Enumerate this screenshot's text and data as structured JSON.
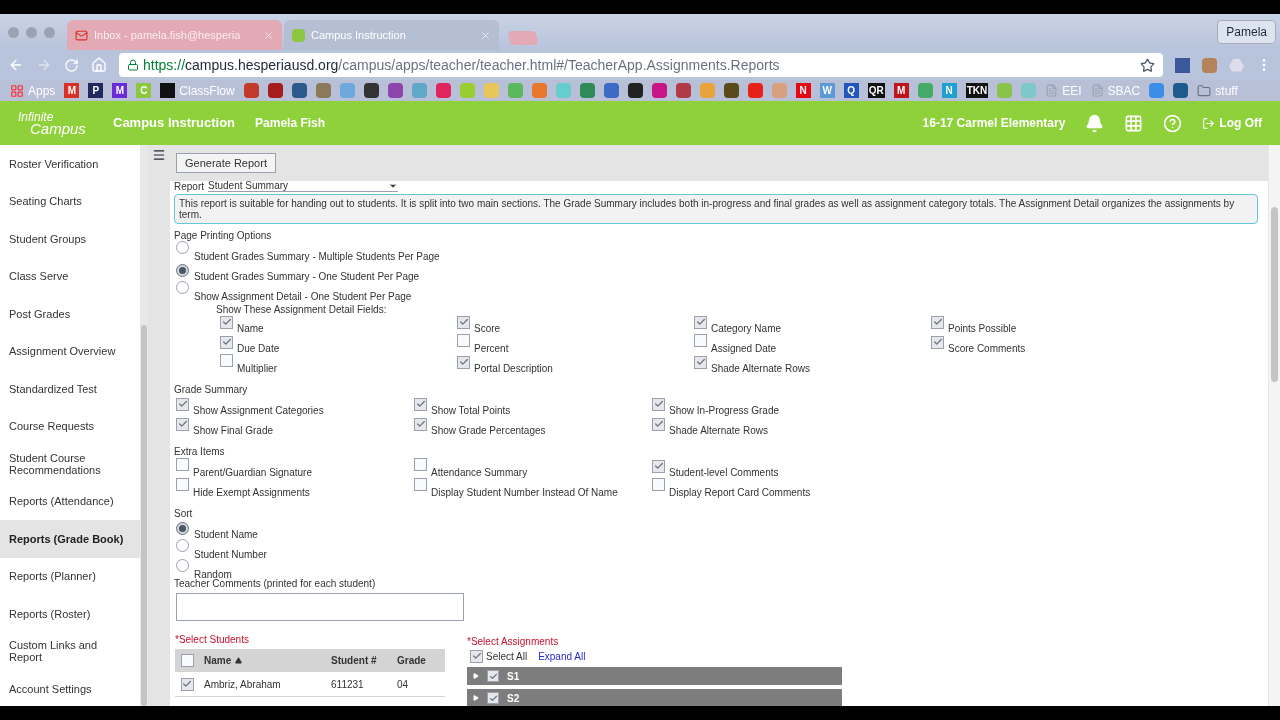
{
  "browser": {
    "tabs": [
      {
        "title": "Inbox - pamela.fish@hesperia",
        "selected": false
      },
      {
        "title": "Campus Instruction",
        "selected": true
      }
    ],
    "profile": "Pamela",
    "address": {
      "scheme": "https://",
      "host": "campus.hesperiausd.org",
      "path": "/campus/apps/teacher/teacher.html#/TeacherApp.Assignments.Reports"
    },
    "bookmarks": [
      {
        "kind": "apps",
        "label": "Apps"
      },
      {
        "kind": "letter",
        "label": "M",
        "color": "#d93025"
      },
      {
        "kind": "letter",
        "label": "P",
        "color": "#1f2a5c"
      },
      {
        "kind": "letter",
        "label": "M",
        "color": "#6b2bd9"
      },
      {
        "kind": "letter",
        "label": "C",
        "color": "#8dc63f"
      },
      {
        "kind": "text",
        "label": "ClassFlow",
        "color": "#111111"
      },
      {
        "kind": "swatch",
        "color": "#c0392b"
      },
      {
        "kind": "swatch",
        "color": "#a61b1b"
      },
      {
        "kind": "swatch",
        "color": "#2c5a8c"
      },
      {
        "kind": "swatch",
        "color": "#8a7a5a"
      },
      {
        "kind": "swatch",
        "color": "#6fa8dc"
      },
      {
        "kind": "swatch",
        "color": "#333333"
      },
      {
        "kind": "swatch",
        "color": "#8e44ad"
      },
      {
        "kind": "swatch",
        "color": "#5fa8c8"
      },
      {
        "kind": "swatch",
        "color": "#e0245e"
      },
      {
        "kind": "swatch",
        "color": "#9acd32"
      },
      {
        "kind": "swatch",
        "color": "#e8c65a"
      },
      {
        "kind": "swatch",
        "color": "#5cb85c"
      },
      {
        "kind": "swatch",
        "color": "#e8772e"
      },
      {
        "kind": "swatch",
        "color": "#66cccc"
      },
      {
        "kind": "swatch",
        "color": "#2e8b57"
      },
      {
        "kind": "swatch",
        "color": "#3b6bc4"
      },
      {
        "kind": "swatch",
        "color": "#222222"
      },
      {
        "kind": "swatch",
        "color": "#c71585"
      },
      {
        "kind": "swatch",
        "color": "#b03a48"
      },
      {
        "kind": "swatch",
        "color": "#e8a33d"
      },
      {
        "kind": "swatch",
        "color": "#5a4a1a"
      },
      {
        "kind": "swatch",
        "color": "#e62117"
      },
      {
        "kind": "swatch",
        "color": "#d9a080"
      },
      {
        "kind": "letter",
        "label": "N",
        "color": "#e50914"
      },
      {
        "kind": "letter",
        "label": "W",
        "color": "#5b9bd5"
      },
      {
        "kind": "letter",
        "label": "Q",
        "color": "#2255bb"
      },
      {
        "kind": "letter",
        "label": "QR",
        "color": "#111111"
      },
      {
        "kind": "letter",
        "label": "M",
        "color": "#c0141c"
      },
      {
        "kind": "swatch",
        "color": "#44aa66"
      },
      {
        "kind": "letter",
        "label": "N",
        "color": "#1ea0d0"
      },
      {
        "kind": "letter",
        "label": "TKN",
        "color": "#111111"
      },
      {
        "kind": "swatch",
        "color": "#8bc34a"
      },
      {
        "kind": "swatch",
        "color": "#7ec8c8"
      },
      {
        "kind": "doc",
        "label": "EEI"
      },
      {
        "kind": "doc",
        "label": "SBAC"
      },
      {
        "kind": "swatch",
        "color": "#3a8ee6"
      },
      {
        "kind": "swatch",
        "color": "#1e5a8c"
      },
      {
        "kind": "folder",
        "label": "stuff"
      }
    ]
  },
  "header": {
    "logo_top": "Infinite",
    "logo_bottom": "Campus",
    "app_title": "Campus Instruction",
    "user": "Pamela Fish",
    "school": "16-17 Carmel Elementary",
    "logoff": "Log Off"
  },
  "sidebar": {
    "items": [
      {
        "label": "Roster Verification",
        "selected": false
      },
      {
        "label": "Seating Charts",
        "selected": false
      },
      {
        "label": "Student Groups",
        "selected": false
      },
      {
        "label": "Class Serve",
        "selected": false
      },
      {
        "label": "Post Grades",
        "selected": false
      },
      {
        "label": "Assignment Overview",
        "selected": false
      },
      {
        "label": "Standardized Test",
        "selected": false
      },
      {
        "label": "Course Requests",
        "selected": false
      },
      {
        "label": "Student Course Recommendations",
        "selected": false
      },
      {
        "label": "Reports (Attendance)",
        "selected": false
      },
      {
        "label": "Reports (Grade Book)",
        "selected": true
      },
      {
        "label": "Reports (Planner)",
        "selected": false
      },
      {
        "label": "Reports (Roster)",
        "selected": false
      },
      {
        "label": "Custom Links and Report",
        "selected": false
      },
      {
        "label": "Account Settings",
        "selected": false
      }
    ]
  },
  "generate_button": "Generate Report",
  "report": {
    "label": "Report",
    "value": "Student Summary"
  },
  "description": "This report is suitable for handing out to students. It is split into two main sections. The Grade Summary includes both in-progress and final grades as well as assignment category totals. The Assignment Detail organizes the assignments by term.",
  "page_printing": {
    "title": "Page Printing Options",
    "options": [
      {
        "label": "Student Grades Summary - Multiple Students Per Page",
        "selected": false
      },
      {
        "label": "Student Grades Summary - One Student Per Page",
        "selected": true
      },
      {
        "label": "Show Assignment Detail - One Student Per Page",
        "selected": false
      }
    ],
    "detail_title": "Show These Assignment Detail Fields:",
    "detail_fields": [
      {
        "label": "Name",
        "checked": true
      },
      {
        "label": "Score",
        "checked": true
      },
      {
        "label": "Category Name",
        "checked": true
      },
      {
        "label": "Points Possible",
        "checked": true
      },
      {
        "label": "Due Date",
        "checked": true
      },
      {
        "label": "Percent",
        "checked": false
      },
      {
        "label": "Assigned Date",
        "checked": false
      },
      {
        "label": "Score Comments",
        "checked": true
      },
      {
        "label": "Multiplier",
        "checked": false
      },
      {
        "label": "Portal Description",
        "checked": true
      },
      {
        "label": "Shade Alternate Rows",
        "checked": true
      }
    ]
  },
  "grade_summary": {
    "title": "Grade Summary",
    "options": [
      {
        "label": "Show Assignment Categories",
        "checked": true
      },
      {
        "label": "Show Total Points",
        "checked": true
      },
      {
        "label": "Show In-Progress Grade",
        "checked": true
      },
      {
        "label": "Show Final Grade",
        "checked": true
      },
      {
        "label": "Show Grade Percentages",
        "checked": true
      },
      {
        "label": "Shade Alternate Rows",
        "checked": true
      }
    ]
  },
  "extra_items": {
    "title": "Extra Items",
    "options": [
      {
        "label": "Parent/Guardian Signature",
        "checked": false
      },
      {
        "label": "Attendance Summary",
        "checked": false
      },
      {
        "label": "Student-level Comments",
        "checked": true
      },
      {
        "label": "Hide Exempt Assignments",
        "checked": false
      },
      {
        "label": "Display Student Number Instead Of Name",
        "checked": false
      },
      {
        "label": "Display Report Card Comments",
        "checked": false
      }
    ]
  },
  "sort": {
    "title": "Sort",
    "options": [
      {
        "label": "Student Name",
        "selected": true
      },
      {
        "label": "Student Number",
        "selected": false
      },
      {
        "label": "Random",
        "selected": false
      }
    ]
  },
  "teacher_comments": {
    "label": "Teacher Comments (printed for each student)"
  },
  "students": {
    "title": "*Select Students",
    "all_checked": false,
    "columns": [
      "Name",
      "Student #",
      "Grade"
    ],
    "rows": [
      {
        "checked": true,
        "cells": [
          "Ambriz, Abraham",
          "611231",
          "04"
        ]
      }
    ]
  },
  "assignments": {
    "title": "*Select Assignments",
    "select_all": {
      "label": "Select All",
      "checked": true
    },
    "expand_all": "Expand All",
    "groups": [
      {
        "label": "S1",
        "checked": true
      },
      {
        "label": "S2",
        "checked": true
      }
    ]
  }
}
